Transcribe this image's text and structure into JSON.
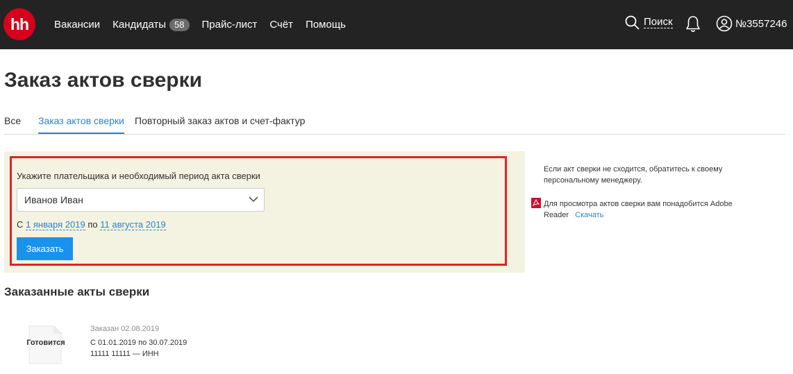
{
  "header": {
    "logo_text": "hh",
    "nav": [
      {
        "label": "Вакансии"
      },
      {
        "label": "Кандидаты",
        "badge": "58"
      },
      {
        "label": "Прайс-лист"
      },
      {
        "label": "Счёт"
      },
      {
        "label": "Помощь"
      }
    ],
    "search_label": "Поиск",
    "account_label": "№3557246",
    "icons": {
      "search": "search-icon",
      "bell": "bell-icon",
      "account": "user-icon"
    }
  },
  "page_title": "Заказ актов сверки",
  "tabs": [
    {
      "label": "Все"
    },
    {
      "label": "Заказ актов сверки",
      "active": true
    },
    {
      "label": "Повторный заказ актов и счет-фактур"
    }
  ],
  "order_form": {
    "label": "Укажите плательщика и необходимый период акта сверки",
    "payer": "Иванов Иван",
    "from_prefix": "С",
    "from_date": "1 января 2019",
    "to_prefix": "по",
    "to_date": "11 августа 2019",
    "submit_label": "Заказать"
  },
  "sidebar_info": {
    "text1": "Если акт сверки не сходится, обратитесь к своему персональному менеджеру.",
    "text2": "Для просмотра актов сверки вам понадобится Adobe Reader",
    "download_label": "Скачать"
  },
  "ordered": {
    "title": "Заказанные акты сверки",
    "items": [
      {
        "status": "Готовится",
        "ordered_date": "Заказан 02.08.2019",
        "period": "С 01.01.2019 по 30.07.2019",
        "inn": "11111 11111 — ИНН"
      }
    ]
  },
  "colors": {
    "header_bg": "#232323",
    "logo_red": "#d6001c",
    "link_blue": "#2a82cc",
    "button_blue": "#1a91eb",
    "panel_bg": "#f4f2e0",
    "highlight_red": "#e32027"
  }
}
